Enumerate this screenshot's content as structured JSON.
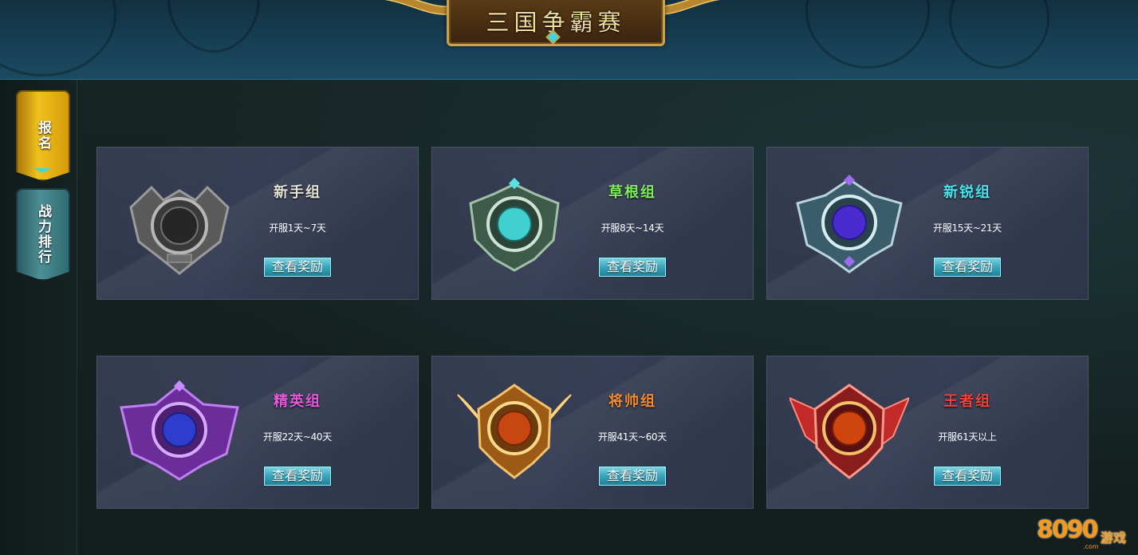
{
  "header": {
    "title": "三国争霸赛"
  },
  "sidebar": {
    "tabs": [
      {
        "label": "报名",
        "active": true
      },
      {
        "label": "战力排行",
        "active": false
      }
    ]
  },
  "groups": [
    {
      "name": "新手组",
      "period": "开服1天~7天",
      "button": "查看奖励",
      "color": "#e3e3d6",
      "emblem": "stone-emblem-icon"
    },
    {
      "name": "草根组",
      "period": "开服8天~14天",
      "button": "查看奖励",
      "color": "#7cf05a",
      "emblem": "jade-emblem-icon"
    },
    {
      "name": "新锐组",
      "period": "开服15天~21天",
      "button": "查看奖励",
      "color": "#47e6ef",
      "emblem": "sapphire-emblem-icon"
    },
    {
      "name": "精英组",
      "period": "开服22天~40天",
      "button": "查看奖励",
      "color": "#e15ad9",
      "emblem": "amethyst-emblem-icon"
    },
    {
      "name": "将帅组",
      "period": "开服41天~60天",
      "button": "查看奖励",
      "color": "#f28c2e",
      "emblem": "gold-emblem-icon"
    },
    {
      "name": "王者组",
      "period": "开服61天以上",
      "button": "查看奖励",
      "color": "#f0413a",
      "emblem": "ruby-emblem-icon"
    }
  ],
  "logo": {
    "digits": "8090",
    "word": "游戏",
    "suffix": ".com"
  }
}
